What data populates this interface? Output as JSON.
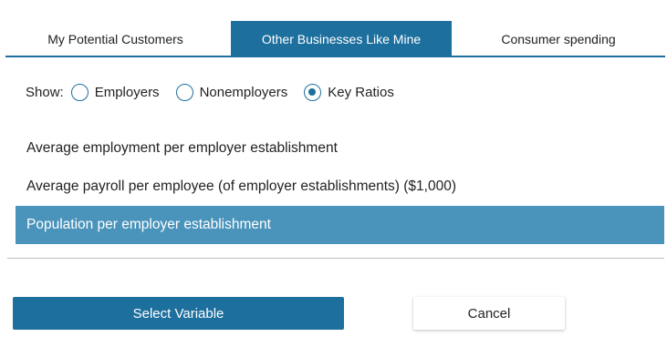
{
  "tabs": [
    {
      "label": "My Potential Customers",
      "active": false
    },
    {
      "label": "Other Businesses Like Mine",
      "active": true
    },
    {
      "label": "Consumer spending",
      "active": false
    }
  ],
  "show": {
    "label": "Show:",
    "options": [
      {
        "label": "Employers",
        "checked": false
      },
      {
        "label": "Nonemployers",
        "checked": false
      },
      {
        "label": "Key Ratios",
        "checked": true
      }
    ]
  },
  "variables": [
    {
      "label": "Average employment per employer establishment",
      "selected": false
    },
    {
      "label": "Average payroll per employee (of employer establishments) ($1,000)",
      "selected": false
    },
    {
      "label": "Population per employer establishment",
      "selected": true
    }
  ],
  "buttons": {
    "select_label": "Select Variable",
    "cancel_label": "Cancel"
  },
  "colors": {
    "accent": "#1d6f9e",
    "selected_row": "#4a93bb"
  }
}
